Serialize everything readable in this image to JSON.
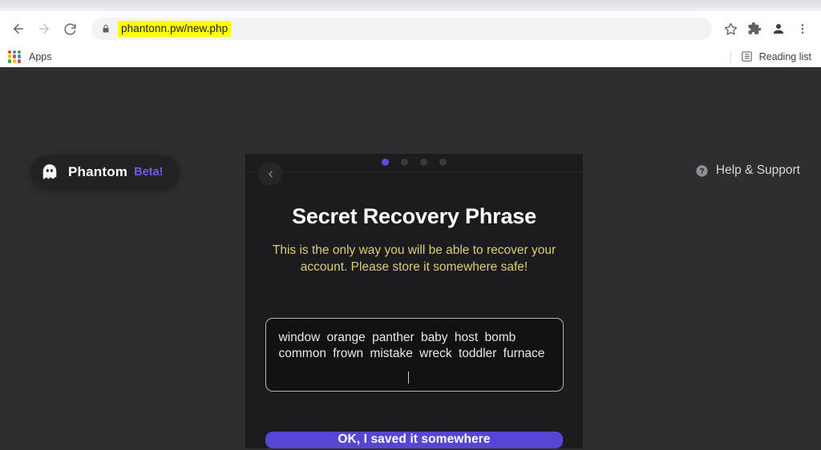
{
  "browser": {
    "nav": {
      "back_icon": "arrow-left-icon",
      "forward_icon": "arrow-right-icon",
      "reload_icon": "reload-icon"
    },
    "omnibox": {
      "lock_icon": "lock-icon",
      "url": "phantonn.pw/new.php",
      "highlight_color": "#fdff00"
    },
    "toolbar_icons": [
      {
        "name": "bookmark-star-icon",
        "glyph": "star"
      },
      {
        "name": "extensions-puzzle-icon",
        "glyph": "puzzle"
      },
      {
        "name": "profile-avatar-icon",
        "glyph": "person"
      },
      {
        "name": "chrome-menu-icon",
        "glyph": "kebab"
      }
    ],
    "bookmarks_bar": {
      "apps_label": "Apps",
      "apps_icon": "apps-grid-icon",
      "reading_list_label": "Reading list",
      "reading_list_icon": "reading-list-icon"
    }
  },
  "page": {
    "background_color": "#2e2e30",
    "brand": {
      "icon": "phantom-ghost-icon",
      "name": "Phantom",
      "badge": "Beta!",
      "badge_color": "#6e5ce8"
    },
    "help": {
      "icon": "help-circle-icon",
      "label": "Help & Support"
    },
    "modal": {
      "back_icon": "chevron-left-icon",
      "steps": {
        "total": 4,
        "active_index": 0,
        "active_color": "#5b4ae0",
        "inactive_color": "#3a3a3d"
      },
      "title": "Secret Recovery Phrase",
      "warning": "This is the only way you will be able to recover your account. Please store it somewhere safe!",
      "warning_color": "#d9cd79",
      "phrase": {
        "words": [
          "window",
          "orange",
          "panther",
          "baby",
          "host",
          "bomb",
          "common",
          "frown",
          "mistake",
          "wreck",
          "toddler",
          "furnace"
        ],
        "text": "window orange panther baby host bomb common frown mistake wreck toddler furnace",
        "word_count": 12,
        "caret_visible": true
      },
      "confirm_button": {
        "label": "OK, I saved it somewhere",
        "color": "#5546d4"
      }
    }
  }
}
